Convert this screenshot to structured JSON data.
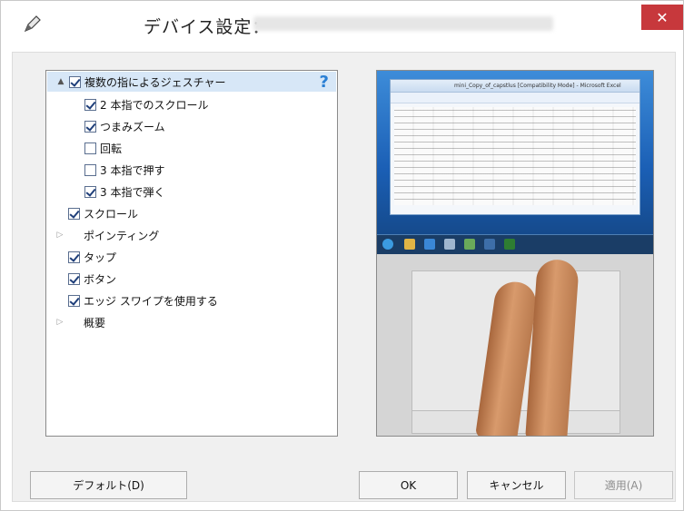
{
  "window": {
    "title": "デバイス設定：",
    "close_symbol": "✕"
  },
  "tree": {
    "help_symbol": "?",
    "items": [
      {
        "label": "複数の指によるジェスチャー",
        "checked": true,
        "expander": "▲"
      },
      {
        "label": "2 本指でのスクロール",
        "checked": true
      },
      {
        "label": "つまみズーム",
        "checked": true
      },
      {
        "label": "回転",
        "checked": false
      },
      {
        "label": "3 本指で押す",
        "checked": false
      },
      {
        "label": "3 本指で弾く",
        "checked": true
      },
      {
        "label": "スクロール",
        "checked": true
      },
      {
        "label": "ポインティング",
        "expander": "▷"
      },
      {
        "label": "タップ",
        "checked": true
      },
      {
        "label": "ボタン",
        "checked": true
      },
      {
        "label": "エッジ スワイプを使用する",
        "checked": true
      },
      {
        "label": "概要",
        "expander": "▷"
      }
    ]
  },
  "preview": {
    "excel_title": "mini_Copy_of_capstlus [Compatibility Mode] - Microsoft Excel"
  },
  "buttons": {
    "default": "デフォルト(D)",
    "ok": "OK",
    "cancel": "キャンセル",
    "apply": "適用(A)"
  },
  "colors": {
    "close_button": "#c7383c",
    "selected_row": "#d7e7f7",
    "help_icon": "#2a7fd4"
  }
}
